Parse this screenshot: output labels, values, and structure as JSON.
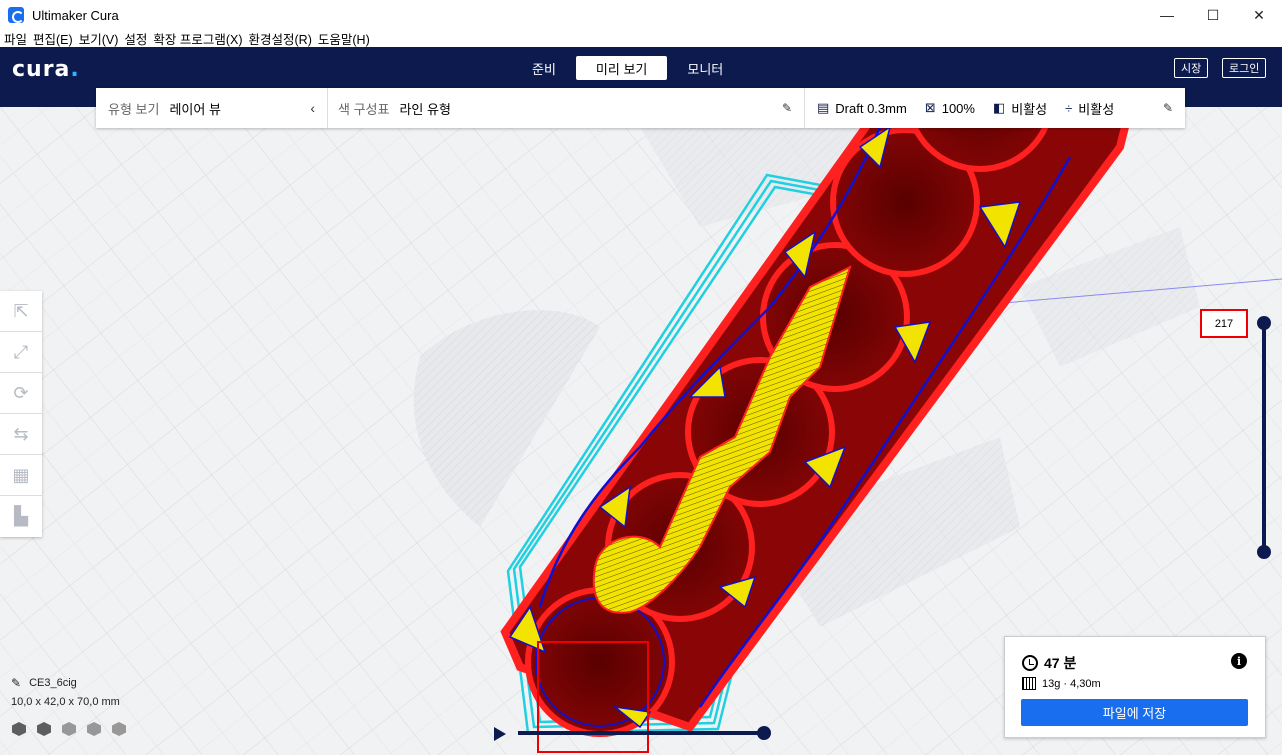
{
  "window": {
    "title": "Ultimaker Cura",
    "minimize": "—",
    "maximize": "☐",
    "close": "✕"
  },
  "menu": [
    "파일",
    "편집(E)",
    "보기(V)",
    "설정",
    "확장 프로그램(X)",
    "환경설정(R)",
    "도움말(H)"
  ],
  "header": {
    "logo_text": "cura",
    "logo_dot": ".",
    "tabs": [
      "준비",
      "미리 보기",
      "모니터"
    ],
    "active_tab": "미리 보기",
    "marketplace_label": "시장",
    "login_label": "로그인"
  },
  "view_panel": {
    "view_type_label": "유형 보기",
    "view_type_value": "레이어 뷰",
    "color_scheme_label": "색 구성표",
    "color_scheme_value": "라인 유형",
    "profile": "Draft 0.3mm",
    "infill": "100%",
    "support": "비활성",
    "adhesion": "비활성"
  },
  "layer": {
    "current": "217"
  },
  "object": {
    "name": "CE3_6cig",
    "dimensions": "10,0 x 42,0 x 70,0 mm"
  },
  "print_info": {
    "time": "47 분",
    "material": "13g · 4,30m",
    "save_label": "파일에 저장"
  },
  "colors": {
    "header_bg": "#0c1a4e",
    "accent": "#196ef0",
    "wall": "#e01010",
    "infill": "#f0e000",
    "skirt": "#20d0e0",
    "inner_wall": "#1010d0"
  }
}
